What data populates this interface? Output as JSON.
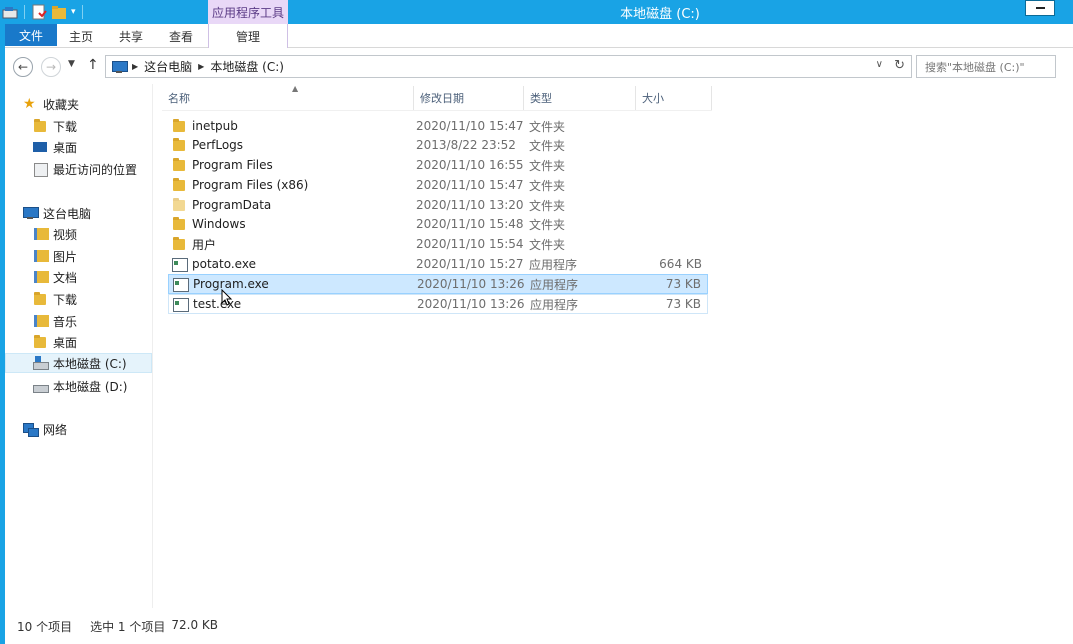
{
  "window": {
    "title": "本地磁盘 (C:)",
    "context_tab_header": "应用程序工具"
  },
  "ribbon": {
    "tabs": [
      {
        "label": "文件"
      },
      {
        "label": "主页"
      },
      {
        "label": "共享"
      },
      {
        "label": "查看"
      },
      {
        "label": "管理"
      }
    ]
  },
  "address": {
    "breadcrumb": [
      "这台电脑",
      "本地磁盘 (C:)"
    ],
    "search_placeholder": "搜索\"本地磁盘 (C:)\""
  },
  "nav_pane": {
    "favorites": {
      "label": "收藏夹",
      "items": [
        "下载",
        "桌面",
        "最近访问的位置"
      ]
    },
    "this_pc": {
      "label": "这台电脑",
      "items": [
        "视频",
        "图片",
        "文档",
        "下载",
        "音乐",
        "桌面",
        "本地磁盘 (C:)",
        "本地磁盘 (D:)"
      ]
    },
    "network": {
      "label": "网络"
    },
    "selected": "本地磁盘 (C:)"
  },
  "columns": {
    "name": "名称",
    "date": "修改日期",
    "type": "类型",
    "size": "大小"
  },
  "files": [
    {
      "name": "inetpub",
      "date": "2020/11/10 15:47",
      "type": "文件夹",
      "size": "",
      "icon": "folder-icon"
    },
    {
      "name": "PerfLogs",
      "date": "2013/8/22 23:52",
      "type": "文件夹",
      "size": "",
      "icon": "folder-icon"
    },
    {
      "name": "Program Files",
      "date": "2020/11/10 16:55",
      "type": "文件夹",
      "size": "",
      "icon": "folder-icon"
    },
    {
      "name": "Program Files (x86)",
      "date": "2020/11/10 15:47",
      "type": "文件夹",
      "size": "",
      "icon": "folder-icon"
    },
    {
      "name": "ProgramData",
      "date": "2020/11/10 13:20",
      "type": "文件夹",
      "size": "",
      "icon": "folder-icon"
    },
    {
      "name": "Windows",
      "date": "2020/11/10 15:48",
      "type": "文件夹",
      "size": "",
      "icon": "folder-icon"
    },
    {
      "name": "用户",
      "date": "2020/11/10 15:54",
      "type": "文件夹",
      "size": "",
      "icon": "folder-icon"
    },
    {
      "name": "potato.exe",
      "date": "2020/11/10 15:27",
      "type": "应用程序",
      "size": "664 KB",
      "icon": "exe-icon"
    },
    {
      "name": "Program.exe",
      "date": "2020/11/10 13:26",
      "type": "应用程序",
      "size": "73 KB",
      "icon": "exe-icon"
    },
    {
      "name": "test.exe",
      "date": "2020/11/10 13:26",
      "type": "应用程序",
      "size": "73 KB",
      "icon": "exe-icon"
    }
  ],
  "selected_file": "Program.exe",
  "status": {
    "item_count": "10 个项目",
    "selected": "选中 1 个项目",
    "selected_size": "72.0 KB"
  },
  "colors": {
    "title_bar": "#19a3e5",
    "file_tab": "#1979ca",
    "context_tab": "#e9d8f7",
    "selection": "#cde8ff"
  }
}
